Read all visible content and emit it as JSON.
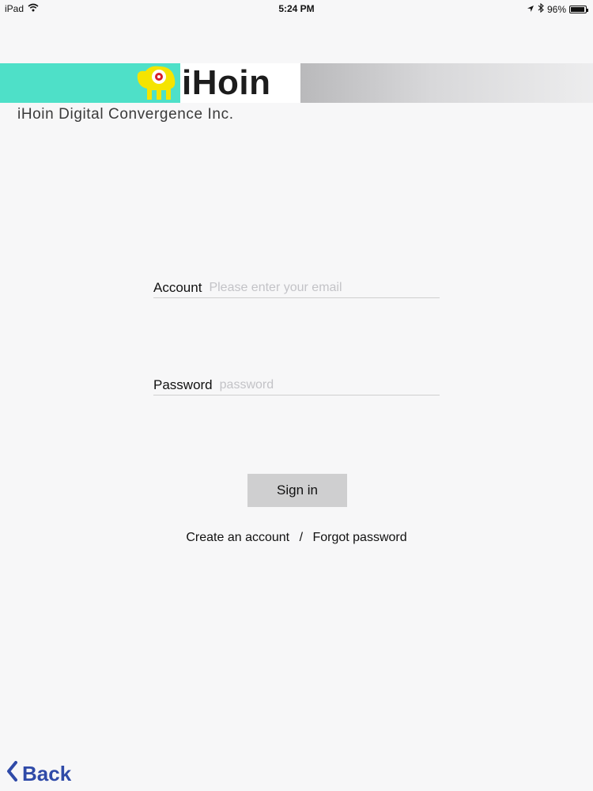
{
  "status_bar": {
    "device": "iPad",
    "time": "5:24 PM",
    "battery": "96%",
    "battery_level": 0.96
  },
  "header": {
    "logo_text": "iHoin",
    "company_name": "iHoin Digital Convergence Inc.",
    "colors": {
      "teal": "#4ee0c8",
      "mascot_yellow": "#f5e400",
      "mascot_red": "#d81e2a"
    }
  },
  "form": {
    "account": {
      "label": "Account",
      "placeholder": "Please enter your email",
      "value": ""
    },
    "password": {
      "label": "Password",
      "placeholder": "password",
      "value": ""
    },
    "signin_label": "Sign in"
  },
  "links": {
    "create_account": "Create an account",
    "separator": "/",
    "forgot_password": "Forgot password"
  },
  "nav": {
    "back_label": "Back",
    "back_color": "#2f4aa8"
  }
}
